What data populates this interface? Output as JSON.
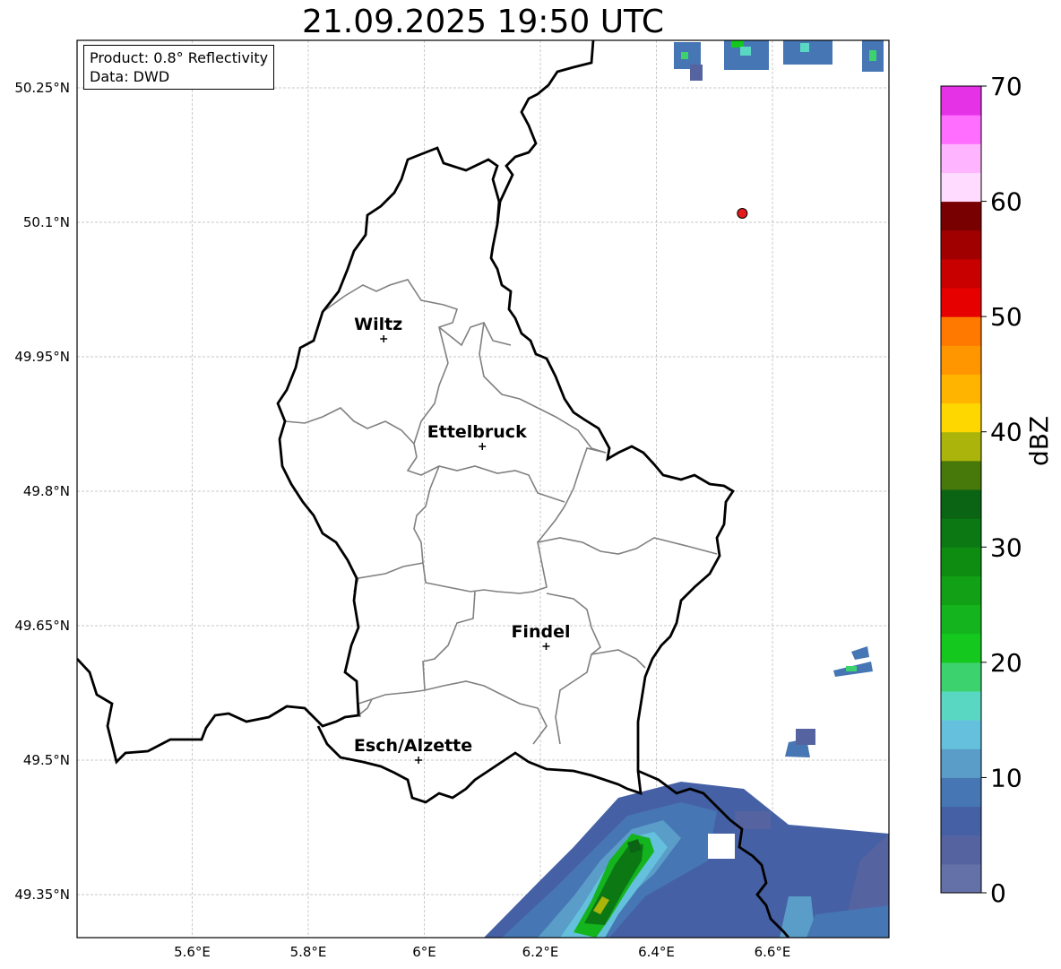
{
  "title": "21.09.2025 19:50 UTC",
  "info": {
    "product": "Product: 0.8° Reflectivity",
    "data": "Data: DWD"
  },
  "map": {
    "lon_range": [
      5.4,
      6.8
    ],
    "lat_range": [
      49.3,
      50.3
    ],
    "lon_ticks": [
      {
        "value": 5.6,
        "label": "5.6°E"
      },
      {
        "value": 5.8,
        "label": "5.8°E"
      },
      {
        "value": 6.0,
        "label": "6°E"
      },
      {
        "value": 6.2,
        "label": "6.2°E"
      },
      {
        "value": 6.4,
        "label": "6.4°E"
      },
      {
        "value": 6.6,
        "label": "6.6°E"
      }
    ],
    "lat_ticks": [
      {
        "value": 49.35,
        "label": "49.35°N"
      },
      {
        "value": 49.5,
        "label": "49.5°N"
      },
      {
        "value": 49.65,
        "label": "49.65°N"
      },
      {
        "value": 49.8,
        "label": "49.8°N"
      },
      {
        "value": 49.95,
        "label": "49.95°N"
      },
      {
        "value": 50.1,
        "label": "50.1°N"
      },
      {
        "value": 50.25,
        "label": "50.25°N"
      }
    ],
    "cities": [
      {
        "name": "Wiltz",
        "lon": 5.93,
        "lat": 49.97
      },
      {
        "name": "Ettelbruck",
        "lon": 6.1,
        "lat": 49.85
      },
      {
        "name": "Findel",
        "lon": 6.21,
        "lat": 49.627
      },
      {
        "name": "Esch/Alzette",
        "lon": 5.99,
        "lat": 49.5
      }
    ],
    "radar_site": {
      "lon": 6.548,
      "lat": 50.11,
      "color": "#e31a1c"
    }
  },
  "colorbar": {
    "label": "dBZ",
    "min": 0,
    "max": 70,
    "ticks": [
      "0",
      "10",
      "20",
      "30",
      "40",
      "50",
      "60",
      "70"
    ],
    "colors": [
      "#6470a8",
      "#5564a0",
      "#4560a5",
      "#4676b4",
      "#5a9dc8",
      "#64c0dc",
      "#5ad7c3",
      "#3cd26e",
      "#14c81e",
      "#14b41e",
      "#12a016",
      "#0e8c12",
      "#0c7814",
      "#0a6414",
      "#46780a",
      "#aab40a",
      "#ffd700",
      "#ffb400",
      "#ff9600",
      "#ff7800",
      "#e60000",
      "#c80000",
      "#a00000",
      "#780000",
      "#ffdcff",
      "#ffb4ff",
      "#ff6eff",
      "#e632e6"
    ]
  }
}
